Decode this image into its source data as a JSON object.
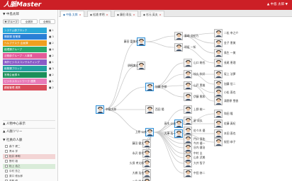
{
  "app": {
    "logo": "人脈Master",
    "user_menu": "▲ 中島 太郎 ▼"
  },
  "sidebar": {
    "header": "▼ 中島太郎",
    "tabs": [
      "▼ グループ",
      "全選択",
      "全解除"
    ],
    "groups": [
      {
        "label": "システム部ブロック",
        "count": "■ 1",
        "color": "#2aa8d8"
      },
      {
        "label": "開発課 営業課",
        "count": "■ 3",
        "color": "#2a7fd6"
      },
      {
        "label": "ヘルプデスク 企画課",
        "count": "■ 2",
        "color": "#f0a020"
      },
      {
        "label": "経理課グループ",
        "count": "■ 4",
        "color": "#2aa86b"
      },
      {
        "label": "法務部グループ・人事課",
        "count": "■ 2",
        "color": "#e35b9a"
      },
      {
        "label": "海外ビジネスコンサルティング",
        "count": "■ 1",
        "color": "#8a5cc7"
      },
      {
        "label": "総務課ブロック",
        "count": "■ 3",
        "color": "#22a0a0"
      },
      {
        "label": "営業企画課 B",
        "count": "■ 2",
        "color": "#1b8f5a"
      },
      {
        "label": "ビジネスネットワーク 連携",
        "count": "■ 1",
        "color": "#e87bb8"
      },
      {
        "label": "顧客管理 連携",
        "count": "■ 2",
        "color": "#d94b5a"
      }
    ],
    "section_center": "▲ 人物中心表示",
    "section_related": "▲ 人脈ツリー",
    "persons_header": "▼ 社員の人脈",
    "persons": [
      {
        "label": "森下 健二",
        "state": ""
      },
      {
        "label": "青木 学",
        "state": ""
      },
      {
        "label": "松井 孝明",
        "state": "sel"
      },
      {
        "label": "野村 雄",
        "state": ""
      },
      {
        "label": "松上 浩之",
        "state": "hl"
      },
      {
        "label": "中村 芳之",
        "state": ""
      },
      {
        "label": "原口 修太郎",
        "state": ""
      },
      {
        "label": "斎藤 優",
        "state": ""
      },
      {
        "label": "中谷 三郎",
        "state": ""
      }
    ]
  },
  "tabs": [
    {
      "label": "中島 太郎",
      "active": true
    },
    {
      "label": "松浦 孝明",
      "active": false
    },
    {
      "label": "藤田 寿弘",
      "active": false
    },
    {
      "label": "杉元 英夫",
      "active": false
    }
  ],
  "tree": {
    "root": {
      "name": "中島太郎"
    },
    "nodes": [
      {
        "id": "n1",
        "name": "藤田 富美代",
        "parent": "root"
      },
      {
        "id": "n2",
        "name": "須崎謙太",
        "parent": "root"
      },
      {
        "id": "n3",
        "name": "加藤 京都",
        "parent": "root"
      },
      {
        "id": "n4",
        "name": "西田 陽",
        "parent": "root"
      },
      {
        "id": "n5",
        "name": "上原 公彦",
        "parent": "root"
      },
      {
        "id": "n6",
        "name": "藤崎 浩紀乃",
        "parent": "n1"
      },
      {
        "id": "n7",
        "name": "明坂 一知",
        "parent": "n1"
      },
      {
        "id": "n8",
        "name": "山口 総也",
        "parent": "n3"
      },
      {
        "id": "n9",
        "name": "桂久 秋好",
        "parent": "n3"
      },
      {
        "id": "n10",
        "name": "山戸 実雄",
        "parent": "n3"
      },
      {
        "id": "n11",
        "name": "伊藤 篤和",
        "parent": "n3"
      },
      {
        "id": "n12",
        "name": "高木 公治",
        "parent": "n5"
      },
      {
        "id": "n13",
        "name": "大澤 浩一",
        "parent": "n5"
      },
      {
        "id": "n14",
        "name": "今井 優一",
        "parent": "n5"
      },
      {
        "id": "n15",
        "name": "中村 圭",
        "parent": "n5"
      },
      {
        "id": "n16",
        "name": "大井 智子",
        "parent": "n5"
      },
      {
        "id": "n17",
        "name": "中田 修二",
        "parent": "n5"
      },
      {
        "id": "n18",
        "name": "藤田 健太",
        "parent": "n5"
      },
      {
        "id": "n19",
        "name": "永沢 香代",
        "parent": "n5"
      },
      {
        "id": "n20",
        "name": "久保 孝太郎",
        "parent": "n5"
      },
      {
        "id": "n21",
        "name": "大橋 浩也",
        "parent": "n5"
      },
      {
        "id": "n22",
        "name": "三島 隆也",
        "parent": "n5"
      },
      {
        "id": "n23",
        "name": "上野 総一",
        "parent": "n5"
      },
      {
        "id": "n24",
        "name": "星 成弘",
        "parent": "n5"
      },
      {
        "id": "n25",
        "name": "佐々木 優",
        "parent": "n5"
      },
      {
        "id": "n26",
        "name": "門口 亜佑",
        "parent": "n5"
      },
      {
        "id": "n27",
        "name": "谷内 健治",
        "parent": "n5"
      },
      {
        "id": "n28",
        "name": "山本 武美",
        "parent": "n5"
      },
      {
        "id": "n29",
        "name": "二松 幸之介",
        "parent": "n6"
      },
      {
        "id": "n30",
        "name": "金子 恵美",
        "parent": "n6"
      },
      {
        "id": "n31",
        "name": "鳥生 一美",
        "parent": "n6"
      },
      {
        "id": "n32",
        "name": "長尾 恵理",
        "parent": "n7"
      },
      {
        "id": "n33",
        "name": "坂上 法夢",
        "parent": "n9"
      },
      {
        "id": "n34",
        "name": "加藤 信二",
        "parent": "n9"
      },
      {
        "id": "n35",
        "name": "小松 直也",
        "parent": "n10"
      },
      {
        "id": "n36",
        "name": "清野原 雪香",
        "parent": "n10"
      },
      {
        "id": "n37",
        "name": "和田 隆",
        "parent": "n12"
      },
      {
        "id": "n38",
        "name": "佐藤 真紀",
        "parent": "n12"
      },
      {
        "id": "n39",
        "name": "本田 直也",
        "parent": "n13"
      },
      {
        "id": "n40",
        "name": "桜田 恭子",
        "parent": "n13"
      }
    ]
  }
}
